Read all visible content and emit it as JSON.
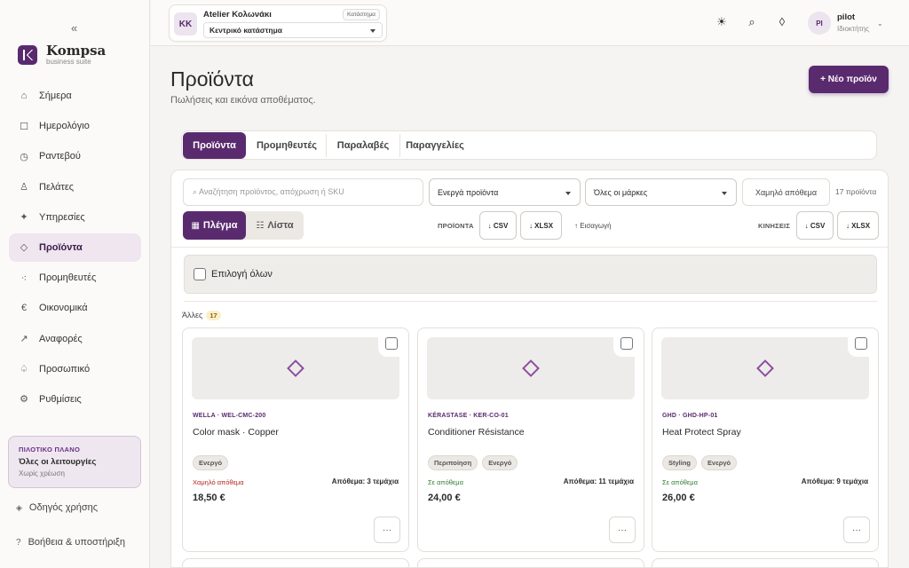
{
  "sidebar": {
    "collapse_glyph": "«",
    "brand": {
      "name": "Kompsa",
      "subtitle": "business suite"
    },
    "items": [
      {
        "label": "Σήμερα",
        "icon": "home-icon",
        "glyph": "⌂"
      },
      {
        "label": "Ημερολόγιο",
        "icon": "calendar-icon",
        "glyph": "☐"
      },
      {
        "label": "Ραντεβού",
        "icon": "clock-icon",
        "glyph": "◷"
      },
      {
        "label": "Πελάτες",
        "icon": "user-icon",
        "glyph": "♙"
      },
      {
        "label": "Υπηρεσίες",
        "icon": "sparkle-icon",
        "glyph": "✦"
      },
      {
        "label": "Προϊόντα",
        "icon": "diamond-icon",
        "glyph": "◇",
        "active": true
      },
      {
        "label": "Προμηθευτές",
        "icon": "network-icon",
        "glyph": "⁖"
      },
      {
        "label": "Οικονομικά",
        "icon": "euro-icon",
        "glyph": "€"
      },
      {
        "label": "Αναφορές",
        "icon": "trend-arrow-icon",
        "glyph": "↗"
      },
      {
        "label": "Προσωπικό",
        "icon": "staff-icon",
        "glyph": "♤"
      },
      {
        "label": "Ρυθμίσεις",
        "icon": "gear-icon",
        "glyph": "⚙"
      }
    ],
    "plan": {
      "title": "ΠΙΛΟΤΙΚΟ ΠΛΑΝΟ",
      "name": "Όλες οι λειτουργίες",
      "note": "Χωρίς χρέωση"
    },
    "guide": {
      "label": "Οδηγός χρήσης",
      "glyph": "◈"
    },
    "help": {
      "label": "Βοήθεια & υποστήριξη",
      "glyph": "?"
    }
  },
  "topbar": {
    "store": {
      "initials": "KK",
      "name": "Atelier Κολωνάκι",
      "badge": "Κατάστημα",
      "selected": "Κεντρικό κατάστημα"
    },
    "icons": {
      "theme": "☀",
      "search": "⌕",
      "notify": "◊"
    },
    "user": {
      "initials": "PI",
      "name": "pilot",
      "role": "Ιδιοκτήτης",
      "chevron": "⌄"
    }
  },
  "page": {
    "title": "Προϊόντα",
    "subtitle": "Πωλήσεις και εικόνα αποθέματος.",
    "new_button": "+ Νέο προϊόν"
  },
  "tabs": [
    "Προϊόντα",
    "Προμηθευτές",
    "Παραλαβές",
    "Παραγγελίες"
  ],
  "filters": {
    "search_placeholder": "⌕  Αναζήτηση προϊόντος, απόχρωση ή SKU",
    "status": "Ενεργά προϊόντα",
    "brand": "Όλες οι μάρκες",
    "low_stock": "Χαμηλό απόθεμα",
    "count": "17 προϊόντα"
  },
  "view": {
    "grid": "Πλέγμα",
    "list": "Λίστα",
    "grid_glyph": "▦",
    "list_glyph": "☷"
  },
  "export": {
    "products_label": "ΠΡΟΪΟΝΤΑ",
    "moves_label": "ΚΙΝΗΣΕΙΣ",
    "csv": "↓ CSV",
    "xlsx": "↓ XLSX",
    "import": "↑ Εισαγωγή"
  },
  "select_all": "Επιλογή όλων",
  "group": {
    "name": "Άλλες",
    "count": "17"
  },
  "products": [
    {
      "sku": "WELLA · WEL-CMC-200",
      "name": "Color mask · Copper",
      "tags": [
        "Ενεργό"
      ],
      "status": "Χαμηλό απόθεμα",
      "status_type": "low",
      "stock": "Απόθεμα: 3 τεμάχια",
      "price": "18,50 €"
    },
    {
      "sku": "KÉRASTASE · KER-CO-01",
      "name": "Conditioner Résistance",
      "tags": [
        "Περιποίηση",
        "Ενεργό"
      ],
      "status": "Σε απόθεμα",
      "status_type": "ok",
      "stock": "Απόθεμα: 11 τεμάχια",
      "price": "24,00 €"
    },
    {
      "sku": "GHD · GHD-HP-01",
      "name": "Heat Protect Spray",
      "tags": [
        "Styling",
        "Ενεργό"
      ],
      "status": "Σε απόθεμα",
      "status_type": "ok",
      "stock": "Απόθεμα: 9 τεμάχια",
      "price": "26,00 €"
    }
  ],
  "more_glyph": "···",
  "colors": {
    "accent": "#5a2a6e",
    "low": "#b3261e",
    "ok": "#2e7d32",
    "bg": "#f5f4f2"
  }
}
